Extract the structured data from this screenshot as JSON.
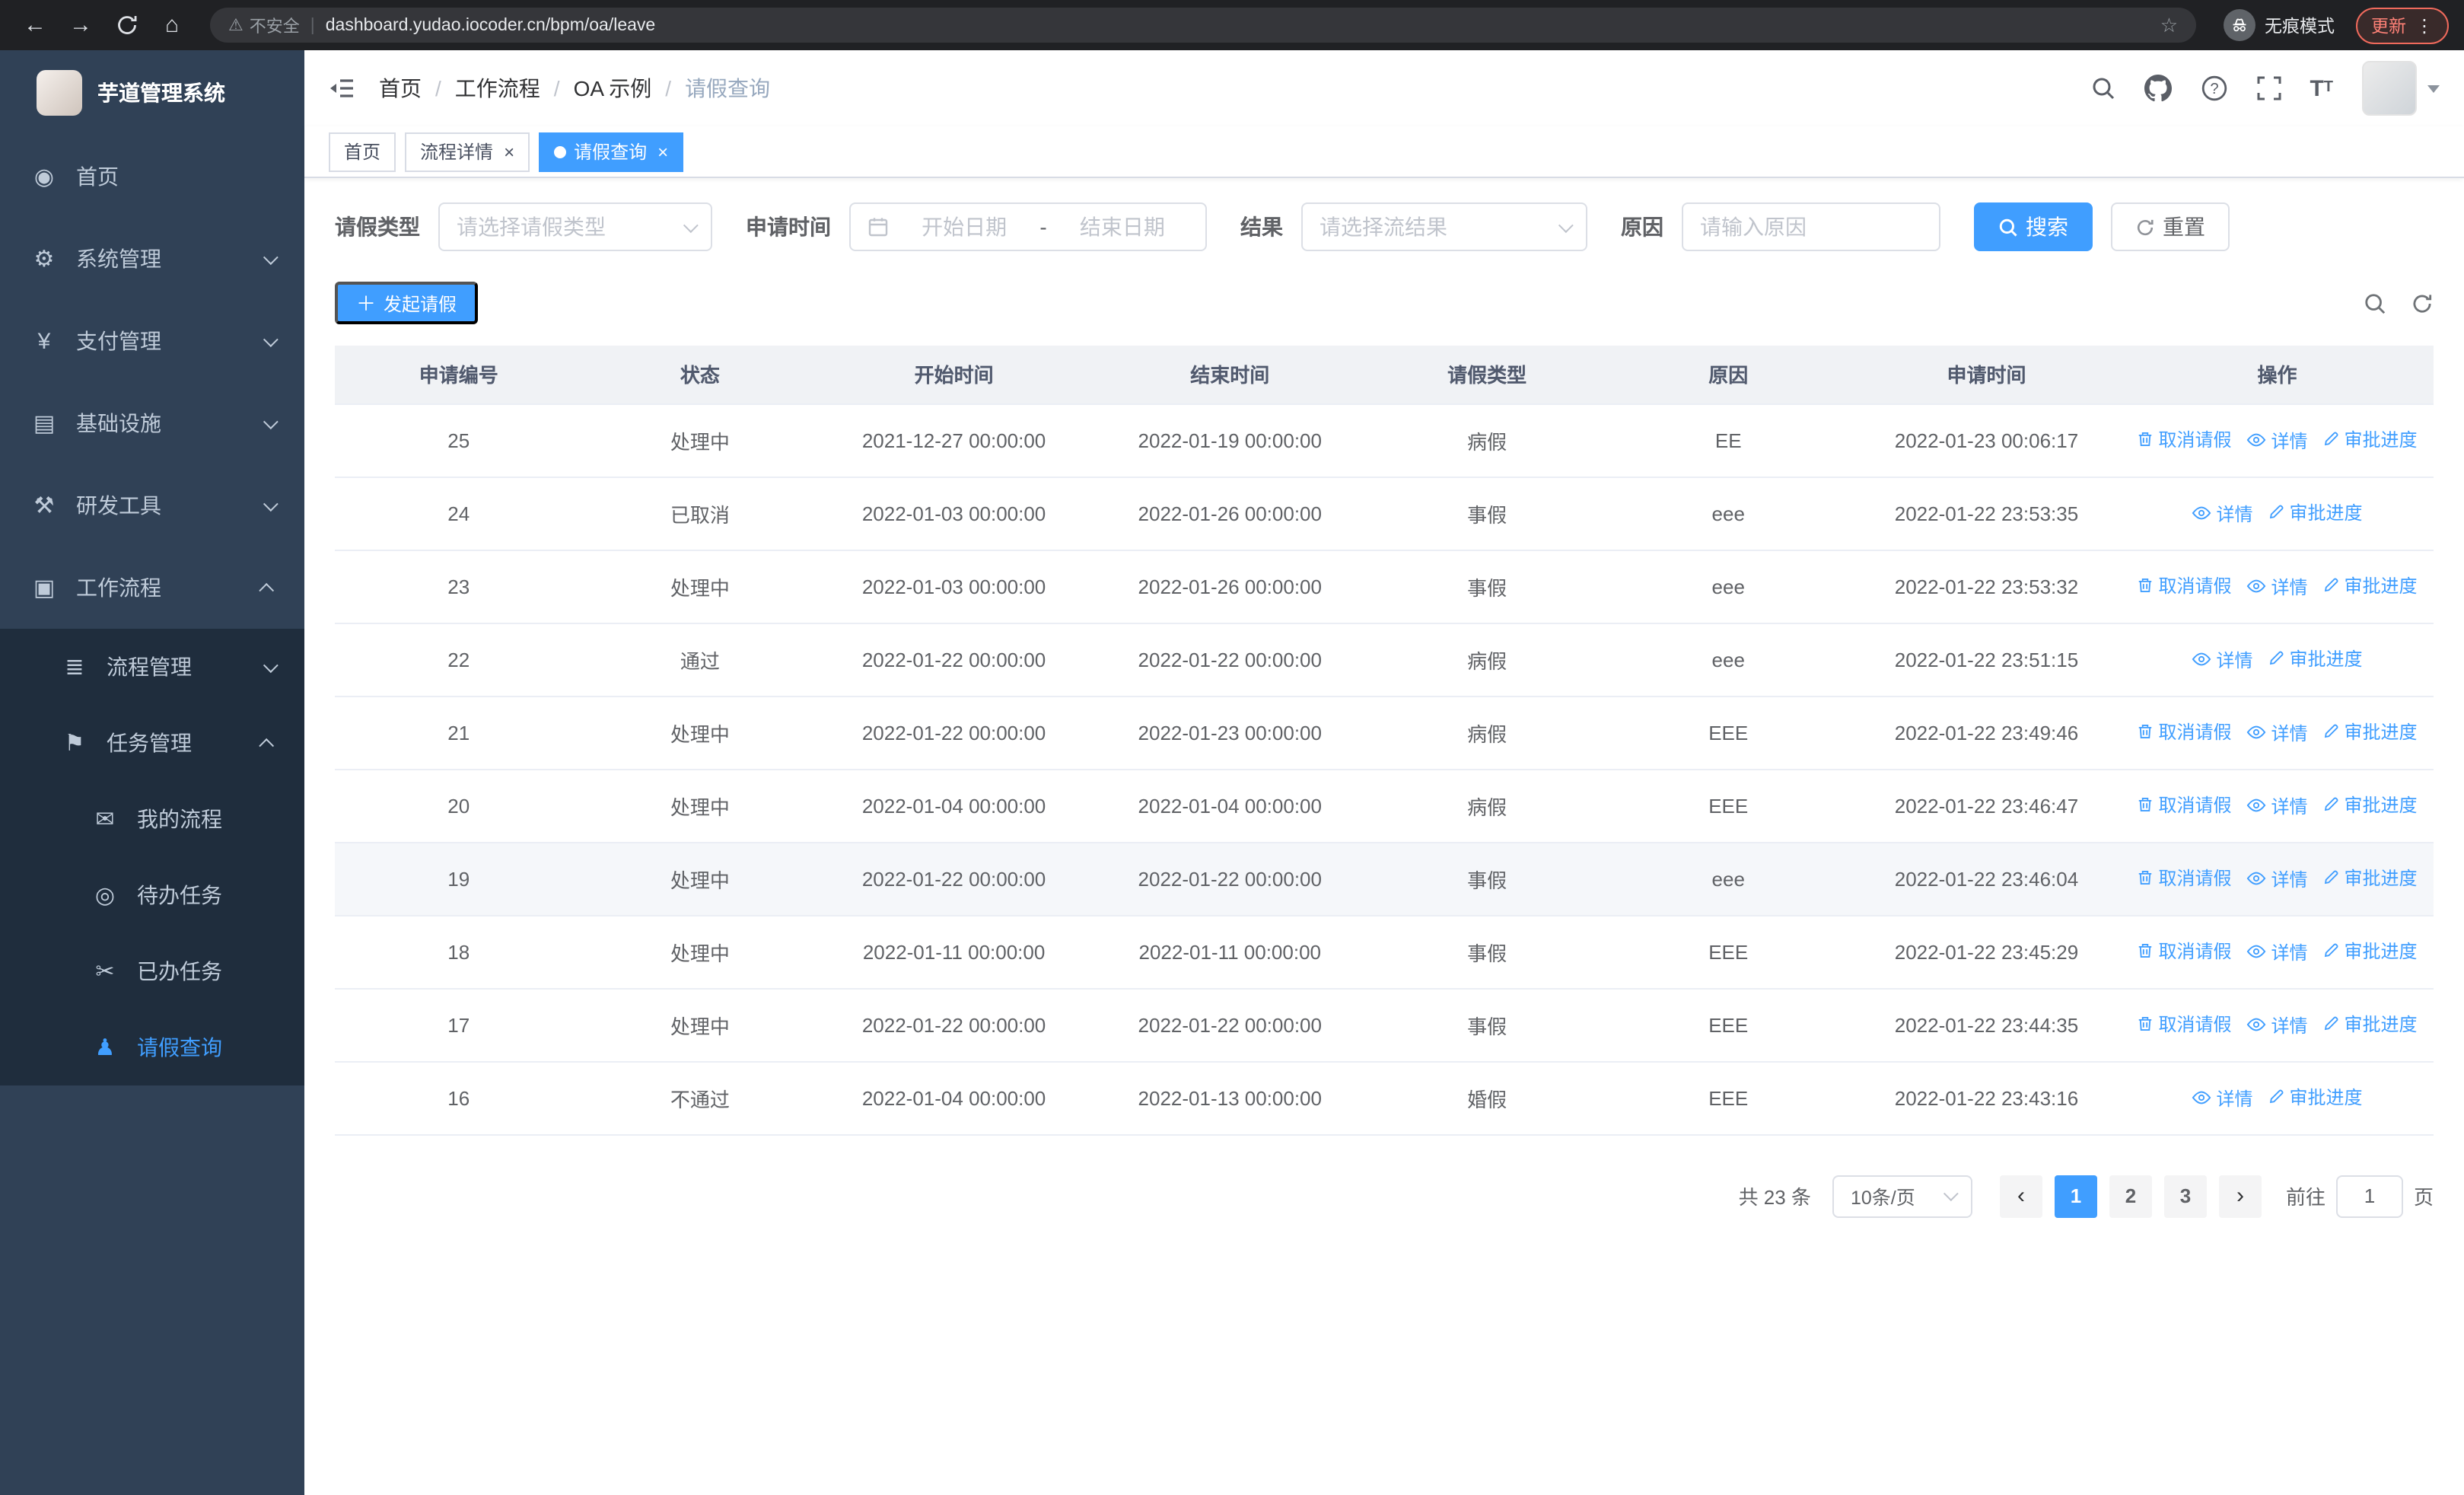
{
  "browser": {
    "security_label": "不安全",
    "url": "dashboard.yudao.iocoder.cn/bpm/oa/leave",
    "profile_label": "无痕模式",
    "update_button": "更新"
  },
  "icons": {
    "dashboard-icon": "◉",
    "gear-icon": "⚙",
    "yen-icon": "¥",
    "infra-icon": "▤",
    "tools-icon": "⚒",
    "workflow-icon": "▣",
    "process-icon": "≣",
    "task-icon": "⚑",
    "my-process-icon": "✉",
    "todo-icon": "◎",
    "done-icon": "✂",
    "leave-icon": "♟"
  },
  "sidebar": {
    "app_title": "芋道管理系统",
    "items": [
      {
        "key": "home",
        "label": "首页",
        "icon": "dashboard-icon",
        "level": 1
      },
      {
        "key": "system",
        "label": "系统管理",
        "icon": "gear-icon",
        "level": 1,
        "chevron": "down"
      },
      {
        "key": "payment",
        "label": "支付管理",
        "icon": "yen-icon",
        "level": 1,
        "chevron": "down"
      },
      {
        "key": "infrastructure",
        "label": "基础设施",
        "icon": "infra-icon",
        "level": 1,
        "chevron": "down"
      },
      {
        "key": "dev-tools",
        "label": "研发工具",
        "icon": "tools-icon",
        "level": 1,
        "chevron": "down"
      },
      {
        "key": "workflow",
        "label": "工作流程",
        "icon": "workflow-icon",
        "level": 1,
        "chevron": "up"
      },
      {
        "key": "process-mgmt",
        "label": "流程管理",
        "icon": "process-icon",
        "level": 2,
        "chevron": "down"
      },
      {
        "key": "task-mgmt",
        "label": "任务管理",
        "icon": "task-icon",
        "level": 2,
        "chevron": "up"
      },
      {
        "key": "my-process",
        "label": "我的流程",
        "icon": "my-process-icon",
        "level": 3
      },
      {
        "key": "todo-tasks",
        "label": "待办任务",
        "icon": "todo-icon",
        "level": 3
      },
      {
        "key": "done-tasks",
        "label": "已办任务",
        "icon": "done-icon",
        "level": 3
      },
      {
        "key": "leave-query",
        "label": "请假查询",
        "icon": "leave-icon",
        "level": 3,
        "active": true
      }
    ]
  },
  "header": {
    "breadcrumb": [
      "首页",
      "工作流程",
      "OA 示例",
      "请假查询"
    ]
  },
  "tabs": [
    {
      "label": "首页",
      "closable": false,
      "active": false
    },
    {
      "label": "流程详情",
      "closable": true,
      "active": false
    },
    {
      "label": "请假查询",
      "closable": true,
      "active": true
    }
  ],
  "filters": {
    "leave_type_label": "请假类型",
    "leave_type_placeholder": "请选择请假类型",
    "apply_time_label": "申请时间",
    "start_date_placeholder": "开始日期",
    "range_separator": "-",
    "end_date_placeholder": "结束日期",
    "result_label": "结果",
    "result_placeholder": "请选择流结果",
    "reason_label": "原因",
    "reason_placeholder": "请输入原因",
    "search_button": "搜索",
    "reset_button": "重置"
  },
  "toolbar": {
    "create_button": "发起请假"
  },
  "table": {
    "columns": [
      "申请编号",
      "状态",
      "开始时间",
      "结束时间",
      "请假类型",
      "原因",
      "申请时间",
      "操作"
    ],
    "actions": {
      "cancel": "取消请假",
      "detail": "详情",
      "progress": "审批进度"
    },
    "rows": [
      {
        "id": "25",
        "status": "处理中",
        "start": "2021-12-27 00:00:00",
        "end": "2022-01-19 00:00:00",
        "type": "病假",
        "reason": "EE",
        "applied": "2022-01-23 00:06:17",
        "cancelable": true,
        "highlight": false
      },
      {
        "id": "24",
        "status": "已取消",
        "start": "2022-01-03 00:00:00",
        "end": "2022-01-26 00:00:00",
        "type": "事假",
        "reason": "eee",
        "applied": "2022-01-22 23:53:35",
        "cancelable": false,
        "highlight": false
      },
      {
        "id": "23",
        "status": "处理中",
        "start": "2022-01-03 00:00:00",
        "end": "2022-01-26 00:00:00",
        "type": "事假",
        "reason": "eee",
        "applied": "2022-01-22 23:53:32",
        "cancelable": true,
        "highlight": false
      },
      {
        "id": "22",
        "status": "通过",
        "start": "2022-01-22 00:00:00",
        "end": "2022-01-22 00:00:00",
        "type": "病假",
        "reason": "eee",
        "applied": "2022-01-22 23:51:15",
        "cancelable": false,
        "highlight": false
      },
      {
        "id": "21",
        "status": "处理中",
        "start": "2022-01-22 00:00:00",
        "end": "2022-01-23 00:00:00",
        "type": "病假",
        "reason": "EEE",
        "applied": "2022-01-22 23:49:46",
        "cancelable": true,
        "highlight": false
      },
      {
        "id": "20",
        "status": "处理中",
        "start": "2022-01-04 00:00:00",
        "end": "2022-01-04 00:00:00",
        "type": "病假",
        "reason": "EEE",
        "applied": "2022-01-22 23:46:47",
        "cancelable": true,
        "highlight": false
      },
      {
        "id": "19",
        "status": "处理中",
        "start": "2022-01-22 00:00:00",
        "end": "2022-01-22 00:00:00",
        "type": "事假",
        "reason": "eee",
        "applied": "2022-01-22 23:46:04",
        "cancelable": true,
        "highlight": true
      },
      {
        "id": "18",
        "status": "处理中",
        "start": "2022-01-11 00:00:00",
        "end": "2022-01-11 00:00:00",
        "type": "事假",
        "reason": "EEE",
        "applied": "2022-01-22 23:45:29",
        "cancelable": true,
        "highlight": false
      },
      {
        "id": "17",
        "status": "处理中",
        "start": "2022-01-22 00:00:00",
        "end": "2022-01-22 00:00:00",
        "type": "事假",
        "reason": "EEE",
        "applied": "2022-01-22 23:44:35",
        "cancelable": true,
        "highlight": false
      },
      {
        "id": "16",
        "status": "不通过",
        "start": "2022-01-04 00:00:00",
        "end": "2022-01-13 00:00:00",
        "type": "婚假",
        "reason": "EEE",
        "applied": "2022-01-22 23:43:16",
        "cancelable": false,
        "highlight": false
      }
    ]
  },
  "pagination": {
    "total_text": "共 23 条",
    "page_size": "10条/页",
    "pages": [
      "1",
      "2",
      "3"
    ],
    "active_page": "1",
    "goto_label": "前往",
    "goto_value": "1",
    "goto_suffix": "页"
  }
}
